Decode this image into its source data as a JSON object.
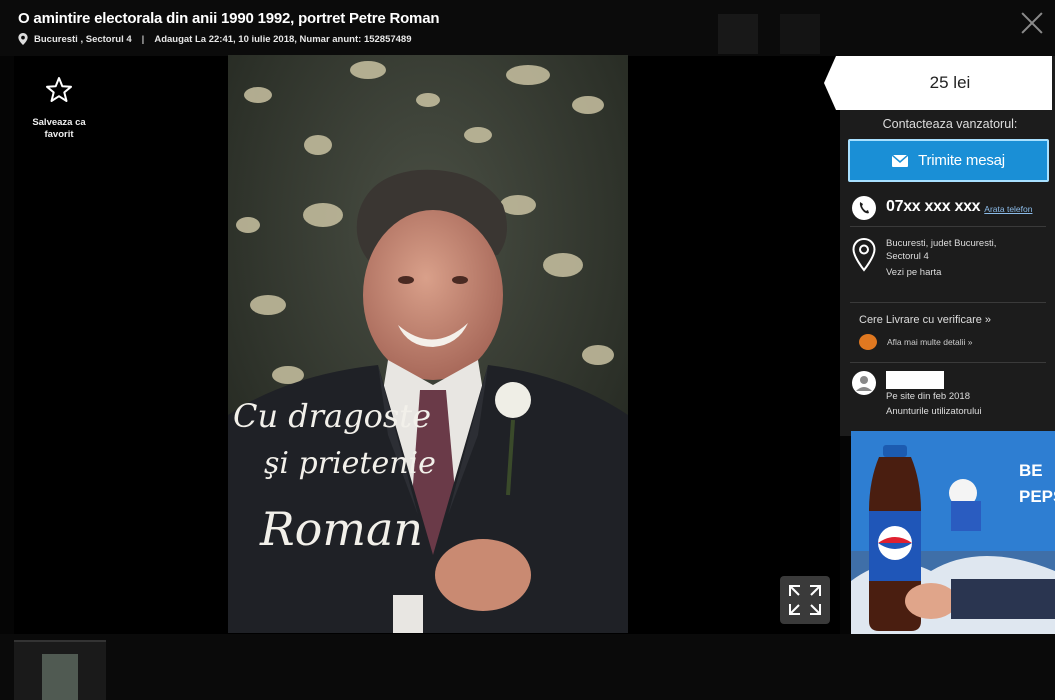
{
  "header": {
    "title": "O amintire electorala din anii 1990 1992, portret Petre Roman",
    "location": "Bucuresti , Sectorul 4",
    "added": "Adaugat La 22:41, 10 iulie 2018, Numar anunt: 152857489"
  },
  "favorite": {
    "label": "Salveaza ca favorit"
  },
  "photo": {
    "caption_line1": "Cu dragoste",
    "caption_line2": "şi prietenie",
    "signature": "Roman"
  },
  "panel": {
    "price": "25 lei",
    "contact_label": "Contacteaza vanzatorul:",
    "message_button": "Trimite mesaj",
    "phone_number": "07xx xxx xxx",
    "show_phone": "Arata telefon",
    "location_line1": "Bucuresti, judet Bucuresti,",
    "location_line2": "Sectorul 4",
    "see_map": "Vezi pe harta",
    "delivery": "Cere Livrare cu verificare »",
    "delivery_more": "Afla mai multe detalii »",
    "user_since": "Pe site din feb 2018",
    "user_ads": "Anunturile utilizatorului"
  },
  "ad": {
    "line1": "BE",
    "line2": "PEPS"
  },
  "colors": {
    "accent": "#1a8fd6",
    "panel": "#1c1c1c",
    "background": "#050505"
  }
}
